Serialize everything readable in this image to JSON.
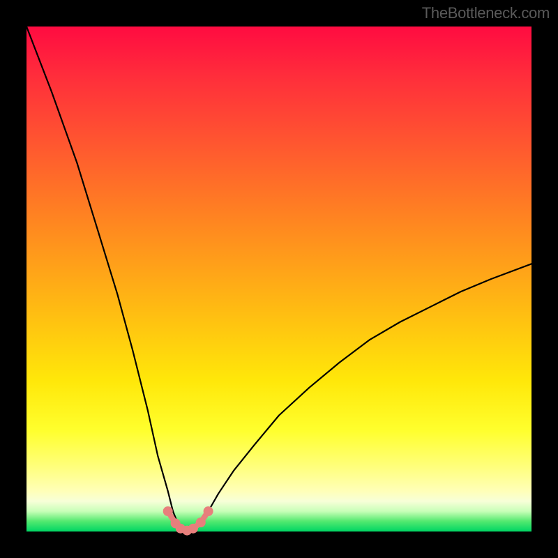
{
  "watermark": "TheBottleneck.com",
  "chart_data": {
    "type": "line",
    "title": "",
    "xlabel": "",
    "ylabel": "",
    "xlim": [
      0,
      1
    ],
    "ylim": [
      0,
      1
    ],
    "series": [
      {
        "name": "bottleneck-curve",
        "x": [
          0.0,
          0.05,
          0.1,
          0.14,
          0.18,
          0.21,
          0.24,
          0.26,
          0.28,
          0.29,
          0.3,
          0.31,
          0.32,
          0.33,
          0.34,
          0.36,
          0.38,
          0.41,
          0.45,
          0.5,
          0.56,
          0.62,
          0.68,
          0.74,
          0.8,
          0.86,
          0.92,
          1.0
        ],
        "y": [
          0.0,
          0.13,
          0.27,
          0.4,
          0.53,
          0.64,
          0.76,
          0.85,
          0.92,
          0.96,
          0.985,
          0.995,
          1.0,
          0.995,
          0.985,
          0.96,
          0.925,
          0.88,
          0.83,
          0.77,
          0.715,
          0.665,
          0.62,
          0.585,
          0.555,
          0.525,
          0.5,
          0.47
        ]
      },
      {
        "name": "trough-markers",
        "x": [
          0.28,
          0.295,
          0.305,
          0.318,
          0.33,
          0.345,
          0.36
        ],
        "y": [
          0.96,
          0.984,
          0.994,
          0.998,
          0.994,
          0.982,
          0.96
        ]
      }
    ],
    "gradient_stops": [
      {
        "pos": 0.0,
        "color": "#ff0b41"
      },
      {
        "pos": 0.55,
        "color": "#ffb813"
      },
      {
        "pos": 0.8,
        "color": "#ffff2d"
      },
      {
        "pos": 1.0,
        "color": "#00d664"
      }
    ],
    "marker_color": "#e77f7c",
    "curve_color": "#000000"
  }
}
